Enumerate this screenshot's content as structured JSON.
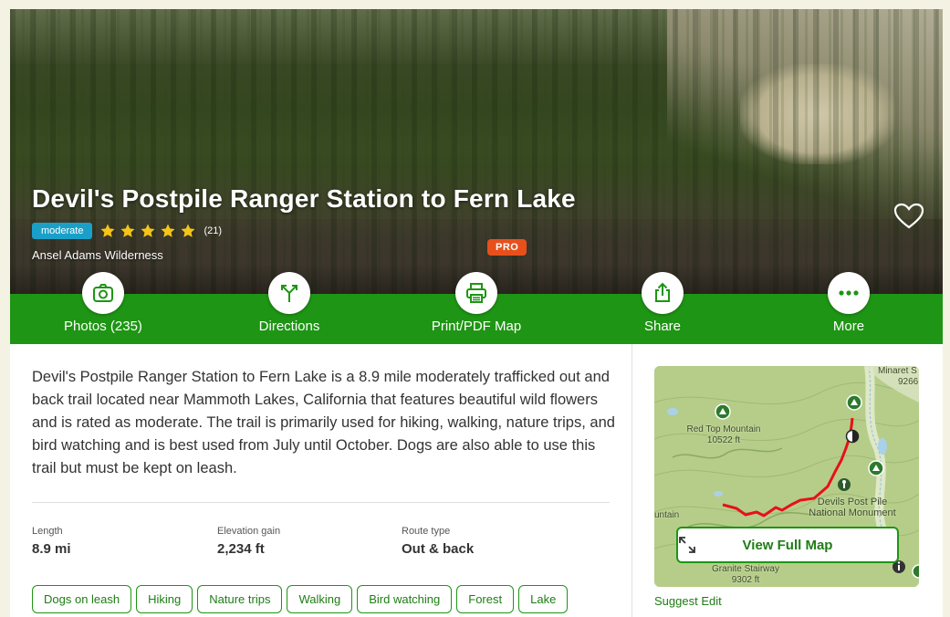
{
  "trail": {
    "title": "Devil's Postpile Ranger Station to Fern Lake",
    "difficulty": "moderate",
    "rating": 5,
    "review_count": "(21)",
    "area": "Ansel Adams Wilderness"
  },
  "actions": [
    {
      "label": "Photos (235)",
      "icon": "camera-icon"
    },
    {
      "label": "Directions",
      "icon": "directions-icon"
    },
    {
      "label": "Print/PDF Map",
      "icon": "printer-icon",
      "badge": "PRO"
    },
    {
      "label": "Share",
      "icon": "share-icon"
    },
    {
      "label": "More",
      "icon": "more-icon"
    }
  ],
  "description": "Devil's Postpile Ranger Station to Fern Lake is a 8.9 mile moderately trafficked out and back trail located near Mammoth Lakes, California that features beautiful wild flowers and is rated as moderate. The trail is primarily used for hiking, walking, nature trips, and bird watching and is best used from July until October. Dogs are also able to use this trail but must be kept on leash.",
  "stats": [
    {
      "key": "Length",
      "value": "8.9 mi"
    },
    {
      "key": "Elevation gain",
      "value": "2,234 ft"
    },
    {
      "key": "Route type",
      "value": "Out & back"
    }
  ],
  "tags": [
    "Dogs on leash",
    "Hiking",
    "Nature trips",
    "Walking",
    "Bird watching",
    "Forest",
    "Lake"
  ],
  "map": {
    "labels": {
      "red_top": "Red Top Mountain",
      "red_top_elev": "10522 ft",
      "minaret": "Minaret S",
      "minaret_elev": "9266",
      "devils": "Devils Post Pile",
      "monument": "National Monument",
      "mountain": "untain",
      "granite": "Granite Stairway",
      "granite_elev": "9302 ft"
    },
    "view_full_map": "View Full Map",
    "suggest_edit": "Suggest Edit"
  },
  "colors": {
    "brand_green": "#1e9514",
    "difficulty_badge": "#1aa0c8",
    "pro_badge": "#e8501b",
    "trail_line": "#e8101a"
  }
}
